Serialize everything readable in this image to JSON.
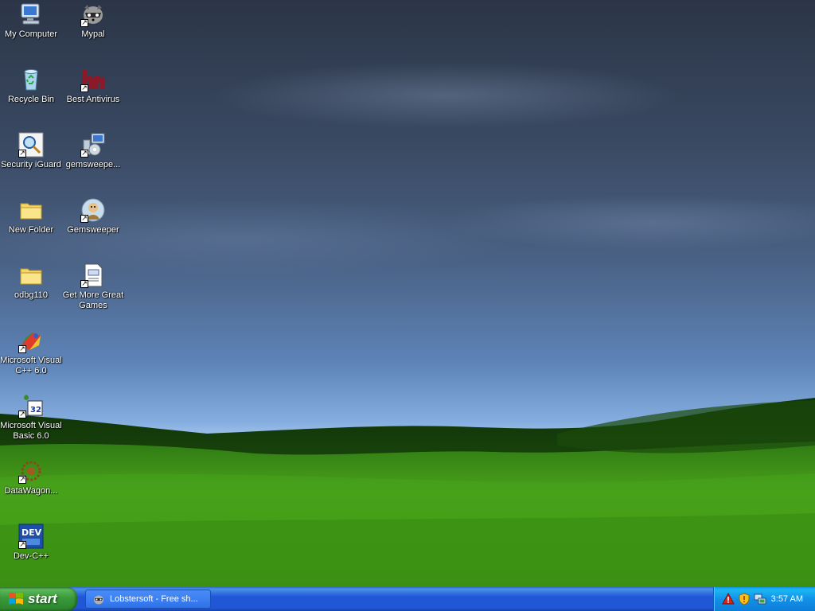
{
  "desktop": {
    "icons": [
      {
        "label": "My Computer",
        "icon": "my-computer-icon",
        "shortcut": false
      },
      {
        "label": "Mypal",
        "icon": "mypal-icon",
        "shortcut": true
      },
      {
        "label": "Recycle Bin",
        "icon": "recycle-bin-icon",
        "shortcut": false
      },
      {
        "label": "Best Antivirus",
        "icon": "best-antivirus-icon",
        "shortcut": true
      },
      {
        "label": "Security iGuard",
        "icon": "security-iguard-icon",
        "shortcut": true
      },
      {
        "label": "gemsweepe...",
        "icon": "installer-icon",
        "shortcut": true
      },
      {
        "label": "New Folder",
        "icon": "folder-icon",
        "shortcut": false
      },
      {
        "label": "Gemsweeper",
        "icon": "gemsweeper-icon",
        "shortcut": true
      },
      {
        "label": "odbg110",
        "icon": "folder-icon",
        "shortcut": false
      },
      {
        "label": "Get More Great Games",
        "icon": "document-icon",
        "shortcut": true
      },
      {
        "label": "Microsoft Visual C++ 6.0",
        "icon": "visual-cpp-icon",
        "shortcut": true
      },
      {
        "label": "Microsoft Visual Basic 6.0",
        "icon": "visual-basic-icon",
        "shortcut": true
      },
      {
        "label": "DataWagon...",
        "icon": "datawagon-icon",
        "shortcut": true
      },
      {
        "label": "Dev-C++",
        "icon": "dev-cpp-icon",
        "shortcut": true
      }
    ]
  },
  "taskbar": {
    "start_label": "start",
    "task_label": "Lobstersoft - Free sh...",
    "clock": "3:57 AM",
    "tray_icons": [
      "security-alert-icon",
      "windows-security-shield-icon",
      "network-icon"
    ]
  }
}
